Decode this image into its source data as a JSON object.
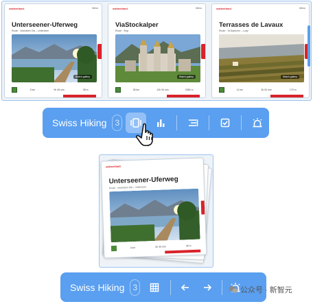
{
  "carousel": {
    "cards": [
      {
        "brand": "switzerland.",
        "menu": "Menu",
        "title": "Unterseener-Uferweg",
        "subtitle": "Route · Interlaken Ost – Unterseen",
        "gallery": "Watch gallery",
        "stats": [
          "3 km",
          "0h 45 min",
          "38 m"
        ]
      },
      {
        "brand": "switzerland.",
        "menu": "Menu",
        "title": "ViaStockalper",
        "subtitle": "Route · Brig",
        "gallery": "Watch gallery",
        "stats": [
          "35 km",
          "12h 00 min",
          "2080 m"
        ]
      },
      {
        "brand": "switzerland.",
        "menu": "Menu",
        "title": "Terrasses de Lavaux",
        "subtitle": "Route · St-Saphorin – Lutry",
        "gallery": "Watch gallery",
        "stats": [
          "11 km",
          "3h 00 min",
          "170 m"
        ]
      }
    ]
  },
  "toolbar_top": {
    "label": "Swiss Hiking",
    "count": "3",
    "buttons": [
      "carousel-view-icon",
      "bar-chart-icon",
      "sort-icon",
      "checkbox-icon",
      "alarm-icon"
    ],
    "active": "carousel-view-icon"
  },
  "stack": {
    "brand": "switzerland.",
    "title": "Unterseener-Uferweg",
    "subtitle": "Route · Interlaken Ost – Unterseen",
    "stats": [
      "3 km",
      "0h 45 min",
      "38 m"
    ]
  },
  "toolbar_bottom": {
    "label": "Swiss Hiking",
    "count": "3",
    "buttons": [
      "grid-icon",
      "arrow-left-icon",
      "arrow-right-icon",
      "alarm-icon"
    ]
  },
  "watermark": {
    "text": "公众号 · 新智元"
  },
  "colors": {
    "toolbar": "#5a9ff0",
    "active_button": "#93c0f6",
    "brand_red": "#d8232a",
    "frame_border": "#9cc3ef"
  }
}
